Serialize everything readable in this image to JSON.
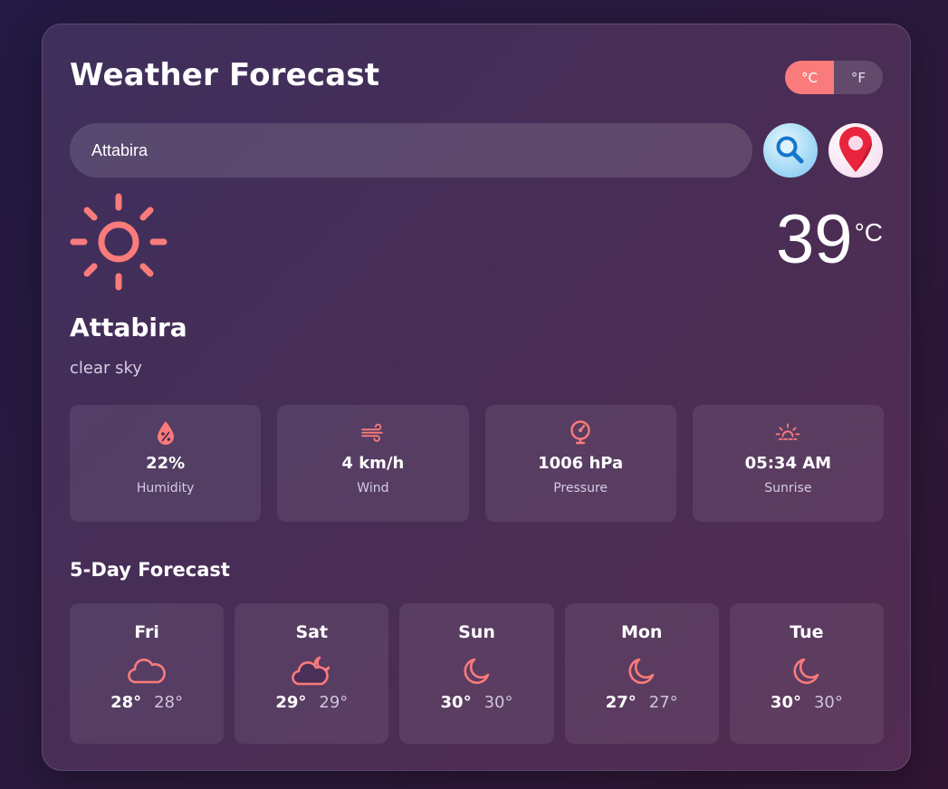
{
  "app": {
    "title": "Weather Forecast",
    "units": {
      "celsius_label": "°C",
      "fahrenheit_label": "°F",
      "selected": "°C"
    },
    "accent_color": "#f97b7b"
  },
  "search": {
    "value": "Attabira",
    "search_icon": "search-icon",
    "location_icon": "location-pin-icon"
  },
  "current": {
    "icon": "sun-icon",
    "temperature": "39",
    "unit": "°C",
    "city": "Attabira",
    "description": "clear sky"
  },
  "stats": [
    {
      "icon": "humidity-icon",
      "value": "22%",
      "label": "Humidity"
    },
    {
      "icon": "wind-icon",
      "value": "4 km/h",
      "label": "Wind"
    },
    {
      "icon": "pressure-icon",
      "value": "1006 hPa",
      "label": "Pressure"
    },
    {
      "icon": "sunrise-icon",
      "value": "05:34 AM",
      "label": "Sunrise"
    }
  ],
  "forecast": {
    "title": "5-Day Forecast",
    "days": [
      {
        "day": "Fri",
        "icon": "cloud-icon",
        "high": "28°",
        "low": "28°"
      },
      {
        "day": "Sat",
        "icon": "cloud-moon-icon",
        "high": "29°",
        "low": "29°"
      },
      {
        "day": "Sun",
        "icon": "moon-icon",
        "high": "30°",
        "low": "30°"
      },
      {
        "day": "Mon",
        "icon": "moon-icon",
        "high": "27°",
        "low": "27°"
      },
      {
        "day": "Tue",
        "icon": "moon-icon",
        "high": "30°",
        "low": "30°"
      }
    ]
  }
}
